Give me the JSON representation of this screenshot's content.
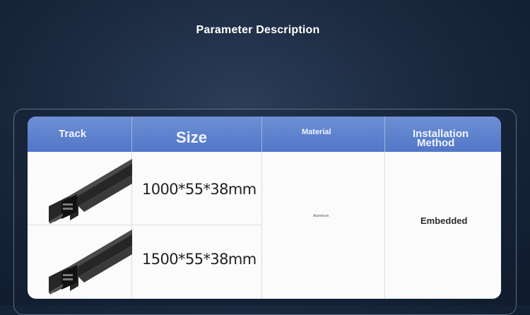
{
  "page": {
    "title": "Parameter Description"
  },
  "table": {
    "headers": {
      "track": "Track",
      "size": "Size",
      "material": "Material",
      "installation_line1": "Installation",
      "installation_line2": "Method"
    },
    "rows": [
      {
        "size": "1000*55*38mm"
      },
      {
        "size": "1500*55*38mm"
      }
    ],
    "material": "Aluminum",
    "installation_method": "Embedded"
  },
  "colors": {
    "header_blue": "#5a7fcc",
    "background_navy": "#1b2a40",
    "rail_black": "#1a1a1a"
  },
  "icons": [
    "track-rail-image"
  ]
}
